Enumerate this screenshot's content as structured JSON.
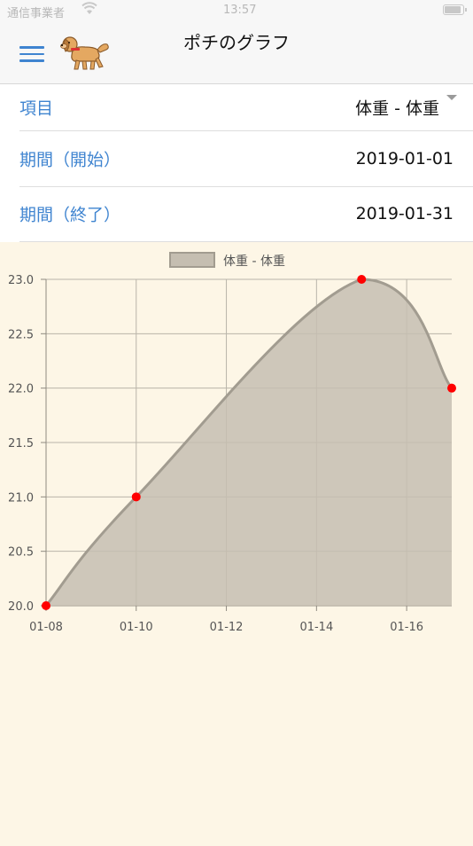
{
  "status_bar": {
    "carrier": "通信事業者",
    "time": "13:57"
  },
  "nav": {
    "title": "ポチのグラフ",
    "menu_icon": "hamburger-menu-icon",
    "logo_icon": "dog-icon"
  },
  "form": {
    "item": {
      "label": "項目",
      "value": "体重 - 体重"
    },
    "start": {
      "label": "期間（開始）",
      "value": "2019-01-01"
    },
    "end": {
      "label": "期間（終了）",
      "value": "2019-01-31"
    }
  },
  "colors": {
    "accent": "#3f84d0",
    "fill": "#c5beb1",
    "line": "#a29c90",
    "point": "#ff0000"
  },
  "chart_data": {
    "type": "area",
    "x": [
      "01-08",
      "01-10",
      "01-15",
      "01-17"
    ],
    "x_days": [
      8,
      10,
      15,
      17
    ],
    "series": [
      {
        "name": "体重 - 体重",
        "values": [
          20.0,
          21.0,
          23.0,
          22.0
        ]
      }
    ],
    "xticks": [
      8,
      10,
      12,
      14,
      16
    ],
    "xtick_labels": [
      "01-08",
      "01-10",
      "01-12",
      "01-14",
      "01-16"
    ],
    "yticks": [
      20.0,
      20.5,
      21.0,
      21.5,
      22.0,
      22.5,
      23.0
    ],
    "ytick_labels": [
      "20.0",
      "20.5",
      "21.0",
      "21.5",
      "22.0",
      "22.5",
      "23.0"
    ],
    "xlim": [
      8,
      17
    ],
    "ylim": [
      20.0,
      23.0
    ],
    "grid": true,
    "legend": "top"
  }
}
